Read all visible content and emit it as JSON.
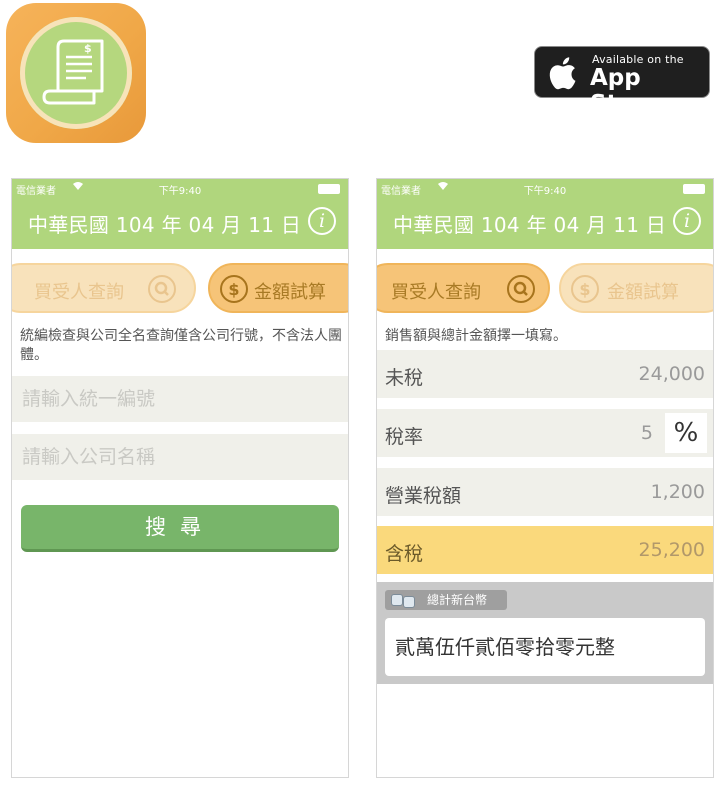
{
  "store_badge": {
    "top_text": "Available on the",
    "main_text": "App Store"
  },
  "status_bar": {
    "carrier": "電信業者",
    "time": "下午9:40"
  },
  "header": {
    "date_title": "中華民國 104 年 04 月 11 日",
    "info_label": "i"
  },
  "tabs": {
    "buyer_query": "買受人查詢",
    "amount_calc": "金額試算"
  },
  "buyer_screen": {
    "hint": "統編檢查與公司全名查詢僅含公司行號，不含法人團體。",
    "tax_id_placeholder": "請輸入統一編號",
    "company_placeholder": "請輸入公司名稱",
    "search_label": "搜尋"
  },
  "calc_screen": {
    "hint": "銷售額與總計金額擇一填寫。",
    "rows": [
      {
        "label": "未稅",
        "value": "24,000"
      },
      {
        "label": "稅率",
        "value": "5"
      },
      {
        "label": "營業稅額",
        "value": "1,200"
      },
      {
        "label": "含稅",
        "value": "25,200"
      }
    ],
    "percent_label": "%",
    "total_chip": "總計新台幣",
    "total_words": "貳萬伍仟貳佰零拾零元整"
  }
}
